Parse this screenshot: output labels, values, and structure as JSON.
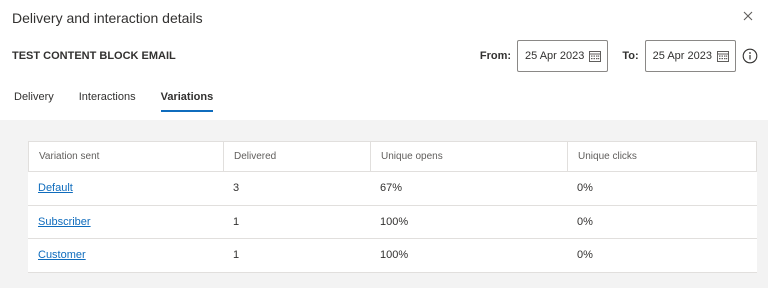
{
  "dialog": {
    "title": "Delivery and interaction details"
  },
  "block": {
    "name": "TEST CONTENT BLOCK EMAIL"
  },
  "dates": {
    "from_label": "From:",
    "from_value": "25 Apr 2023",
    "to_label": "To:",
    "to_value": "25 Apr 2023"
  },
  "tabs": [
    {
      "label": "Delivery",
      "active": false
    },
    {
      "label": "Interactions",
      "active": false
    },
    {
      "label": "Variations",
      "active": true
    }
  ],
  "table": {
    "headers": [
      "Variation sent",
      "Delivered",
      "Unique opens",
      "Unique clicks"
    ],
    "rows": [
      {
        "variation": "Default",
        "delivered": "3",
        "opens": "67%",
        "clicks": "0%"
      },
      {
        "variation": "Subscriber",
        "delivered": "1",
        "opens": "100%",
        "clicks": "0%"
      },
      {
        "variation": "Customer",
        "delivered": "1",
        "opens": "100%",
        "clicks": "0%"
      }
    ]
  },
  "colors": {
    "accent": "#0f6cbd",
    "content_background": "#f3f3f3",
    "border": "#e1dfdd"
  },
  "icons": {
    "close": "close-icon",
    "calendar": "calendar-icon",
    "info": "info-icon"
  }
}
